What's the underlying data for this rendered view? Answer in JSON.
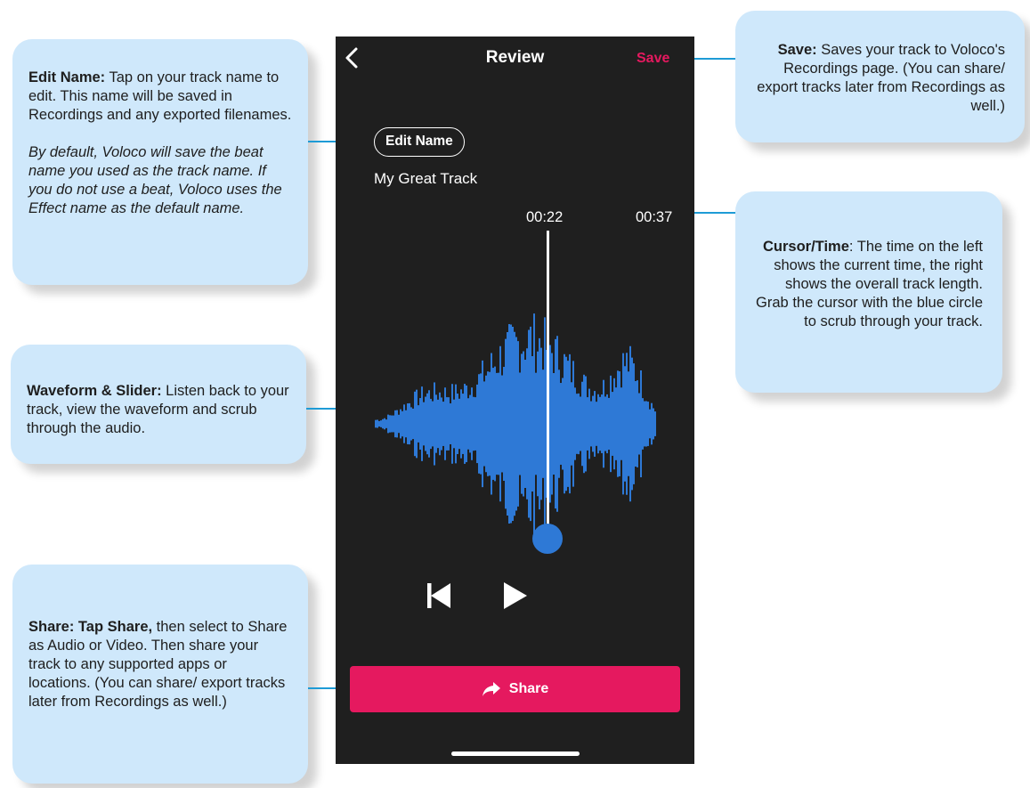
{
  "phone": {
    "title": "Review",
    "save_label": "Save",
    "edit_name_label": "Edit Name",
    "track_name": "My Great Track",
    "current_time": "00:22",
    "total_time": "00:37",
    "playback_progress": 0.59,
    "share_label": "Share",
    "colors": {
      "accent": "#e5195f",
      "waveform": "#2e79d6",
      "background": "#1f1f1f"
    },
    "icons": [
      "chevron-left-icon",
      "skip-back-icon",
      "play-icon",
      "share-arrow-icon"
    ]
  },
  "callouts": {
    "edit_name": {
      "heading": "Edit Name:",
      "body": " Tap on your track name to edit. This name will be saved in Recordings and any exported filenames.",
      "note": "By default, Voloco will save the beat name you used as the track name. If you do not use a beat, Voloco uses the Effect name as the default name."
    },
    "waveform": {
      "heading": "Waveform & Slider:",
      "body": " Listen back to your track, view the waveform and scrub through the audio."
    },
    "share": {
      "heading": "Share:  Tap Share,",
      "body": " then select to Share as Audio or Video. Then share your track to any supported apps or locations. (You can share/ export tracks later from Recordings as well.)"
    },
    "save": {
      "heading": "Save:",
      "body": " Saves your track to Voloco's Recordings page. (You can share/ export tracks later from Recordings as well.)"
    },
    "cursor_time": {
      "heading": "Cursor/Time",
      "body": ": The time on the left shows the current time, the right shows the overall track length. Grab the cursor with the blue circle to scrub through your track."
    }
  }
}
